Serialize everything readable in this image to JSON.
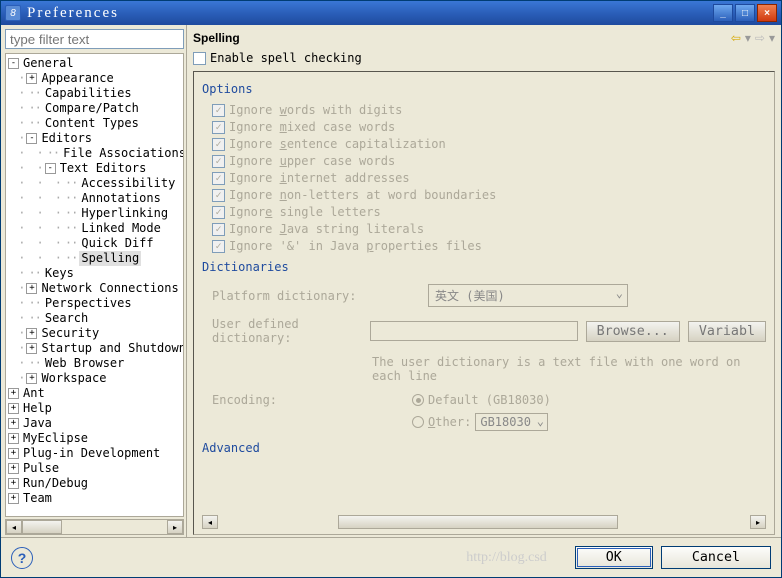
{
  "window": {
    "title": "Preferences"
  },
  "filter_placeholder": "type filter text",
  "tree": [
    {
      "d": 0,
      "e": "-",
      "label": "General"
    },
    {
      "d": 1,
      "e": "+",
      "label": "Appearance"
    },
    {
      "d": 1,
      "e": "",
      "label": "Capabilities"
    },
    {
      "d": 1,
      "e": "",
      "label": "Compare/Patch"
    },
    {
      "d": 1,
      "e": "",
      "label": "Content Types"
    },
    {
      "d": 1,
      "e": "-",
      "label": "Editors"
    },
    {
      "d": 2,
      "e": "",
      "label": "File Associations"
    },
    {
      "d": 2,
      "e": "-",
      "label": "Text Editors"
    },
    {
      "d": 3,
      "e": "",
      "label": "Accessibility"
    },
    {
      "d": 3,
      "e": "",
      "label": "Annotations"
    },
    {
      "d": 3,
      "e": "",
      "label": "Hyperlinking"
    },
    {
      "d": 3,
      "e": "",
      "label": "Linked Mode"
    },
    {
      "d": 3,
      "e": "",
      "label": "Quick Diff"
    },
    {
      "d": 3,
      "e": "",
      "label": "Spelling",
      "selected": true
    },
    {
      "d": 1,
      "e": "",
      "label": "Keys"
    },
    {
      "d": 1,
      "e": "+",
      "label": "Network Connections"
    },
    {
      "d": 1,
      "e": "",
      "label": "Perspectives"
    },
    {
      "d": 1,
      "e": "",
      "label": "Search"
    },
    {
      "d": 1,
      "e": "+",
      "label": "Security"
    },
    {
      "d": 1,
      "e": "+",
      "label": "Startup and Shutdown"
    },
    {
      "d": 1,
      "e": "",
      "label": "Web Browser"
    },
    {
      "d": 1,
      "e": "+",
      "label": "Workspace"
    },
    {
      "d": 0,
      "e": "+",
      "label": "Ant"
    },
    {
      "d": 0,
      "e": "+",
      "label": "Help"
    },
    {
      "d": 0,
      "e": "+",
      "label": "Java"
    },
    {
      "d": 0,
      "e": "+",
      "label": "MyEclipse"
    },
    {
      "d": 0,
      "e": "+",
      "label": "Plug-in Development"
    },
    {
      "d": 0,
      "e": "+",
      "label": "Pulse"
    },
    {
      "d": 0,
      "e": "+",
      "label": "Run/Debug"
    },
    {
      "d": 0,
      "e": "+",
      "label": "Team"
    }
  ],
  "page": {
    "title": "Spelling",
    "enable_label": "Enable spell checking",
    "options_title": "Options",
    "options": [
      {
        "pre": "Ignore ",
        "u": "w",
        "post": "ords with digits"
      },
      {
        "pre": "Ignore ",
        "u": "m",
        "post": "ixed case words"
      },
      {
        "pre": "Ignore ",
        "u": "s",
        "post": "entence capitalization"
      },
      {
        "pre": "Ignore ",
        "u": "u",
        "post": "pper case words"
      },
      {
        "pre": "Ignore ",
        "u": "i",
        "post": "nternet addresses"
      },
      {
        "pre": "Ignore ",
        "u": "n",
        "post": "on-letters at word boundaries"
      },
      {
        "pre": "Ignor",
        "u": "e",
        "post": " single letters"
      },
      {
        "pre": "Ignore ",
        "u": "J",
        "post": "ava string literals"
      },
      {
        "pre": "Ignore '&' in Java ",
        "u": "p",
        "post": "roperties files"
      }
    ],
    "dict_title": "Dictionaries",
    "platform_label": "Platform dictionary:",
    "platform_value": "英文 (美国)",
    "user_label": "User defined dictionary:",
    "browse_label": "Browse...",
    "variables_label": "Variabl",
    "note": "The user dictionary is a text file with one word on each line",
    "encoding_label": "Encoding:",
    "enc_default": "Default (GB18030)",
    "enc_other_label": "Other:",
    "enc_other_value": "GB18030",
    "advanced_title": "Advanced"
  },
  "buttons": {
    "ok": "OK",
    "cancel": "Cancel"
  }
}
